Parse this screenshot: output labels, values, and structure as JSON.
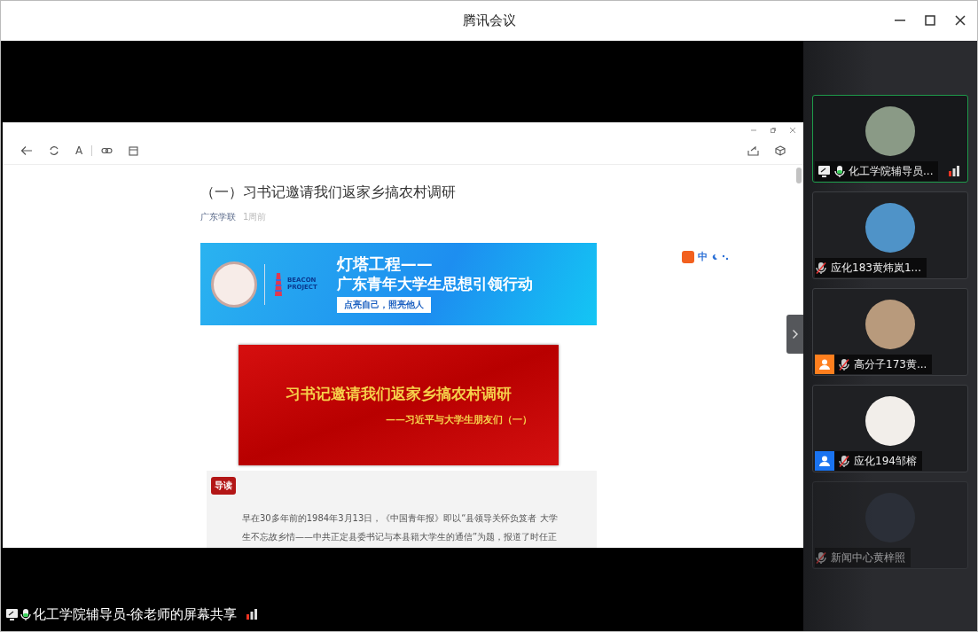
{
  "window": {
    "title": "腾讯会议"
  },
  "shared_window": {
    "toolbar_text_button": "A",
    "article": {
      "title": "（一）习书记邀请我们返家乡搞农村调研",
      "source": "广东学联",
      "time": "1周前",
      "banner_1": {
        "logo_line_1": "BEACON",
        "logo_line_2": "PROJECT",
        "headline_1": "灯塔工程——",
        "headline_2": "广东青年大学生思想引领行动",
        "slogan": "点亮自己，照亮他人"
      },
      "banner_2": {
        "title": "习书记邀请我们返家乡搞农村调研",
        "subtitle": "——习近平与大学生朋友们（一）"
      },
      "intro_tag": "导读",
      "intro_lines": [
        "早在30多年前的1984年3月13日，《中国青年报》即以“县领导关怀负笈者 大学",
        "生不忘故乡情——中共正定县委书记与本县籍大学生的通信”为题，报道了时任正"
      ]
    },
    "ime_indicator": "中"
  },
  "presenter_label": "化工学院辅导员-徐老师的屏幕共享",
  "participants": [
    {
      "name": "化工学院辅导员...",
      "muted": false,
      "active": true,
      "kind": "presenter",
      "signal": true,
      "dimmed": false
    },
    {
      "name": "应化183黄炜岚1...",
      "muted": true,
      "active": false,
      "kind": "plain",
      "signal": false,
      "dimmed": false
    },
    {
      "name": "高分子173黄...",
      "muted": true,
      "active": false,
      "kind": "guest",
      "color": "#ff7f1e",
      "signal": false,
      "dimmed": false
    },
    {
      "name": "应化194邹榕",
      "muted": true,
      "active": false,
      "kind": "guest",
      "color": "#1a73f0",
      "signal": false,
      "dimmed": false
    },
    {
      "name": "新闻中心黄梓照",
      "muted": true,
      "active": false,
      "kind": "plain",
      "signal": false,
      "dimmed": true
    }
  ]
}
